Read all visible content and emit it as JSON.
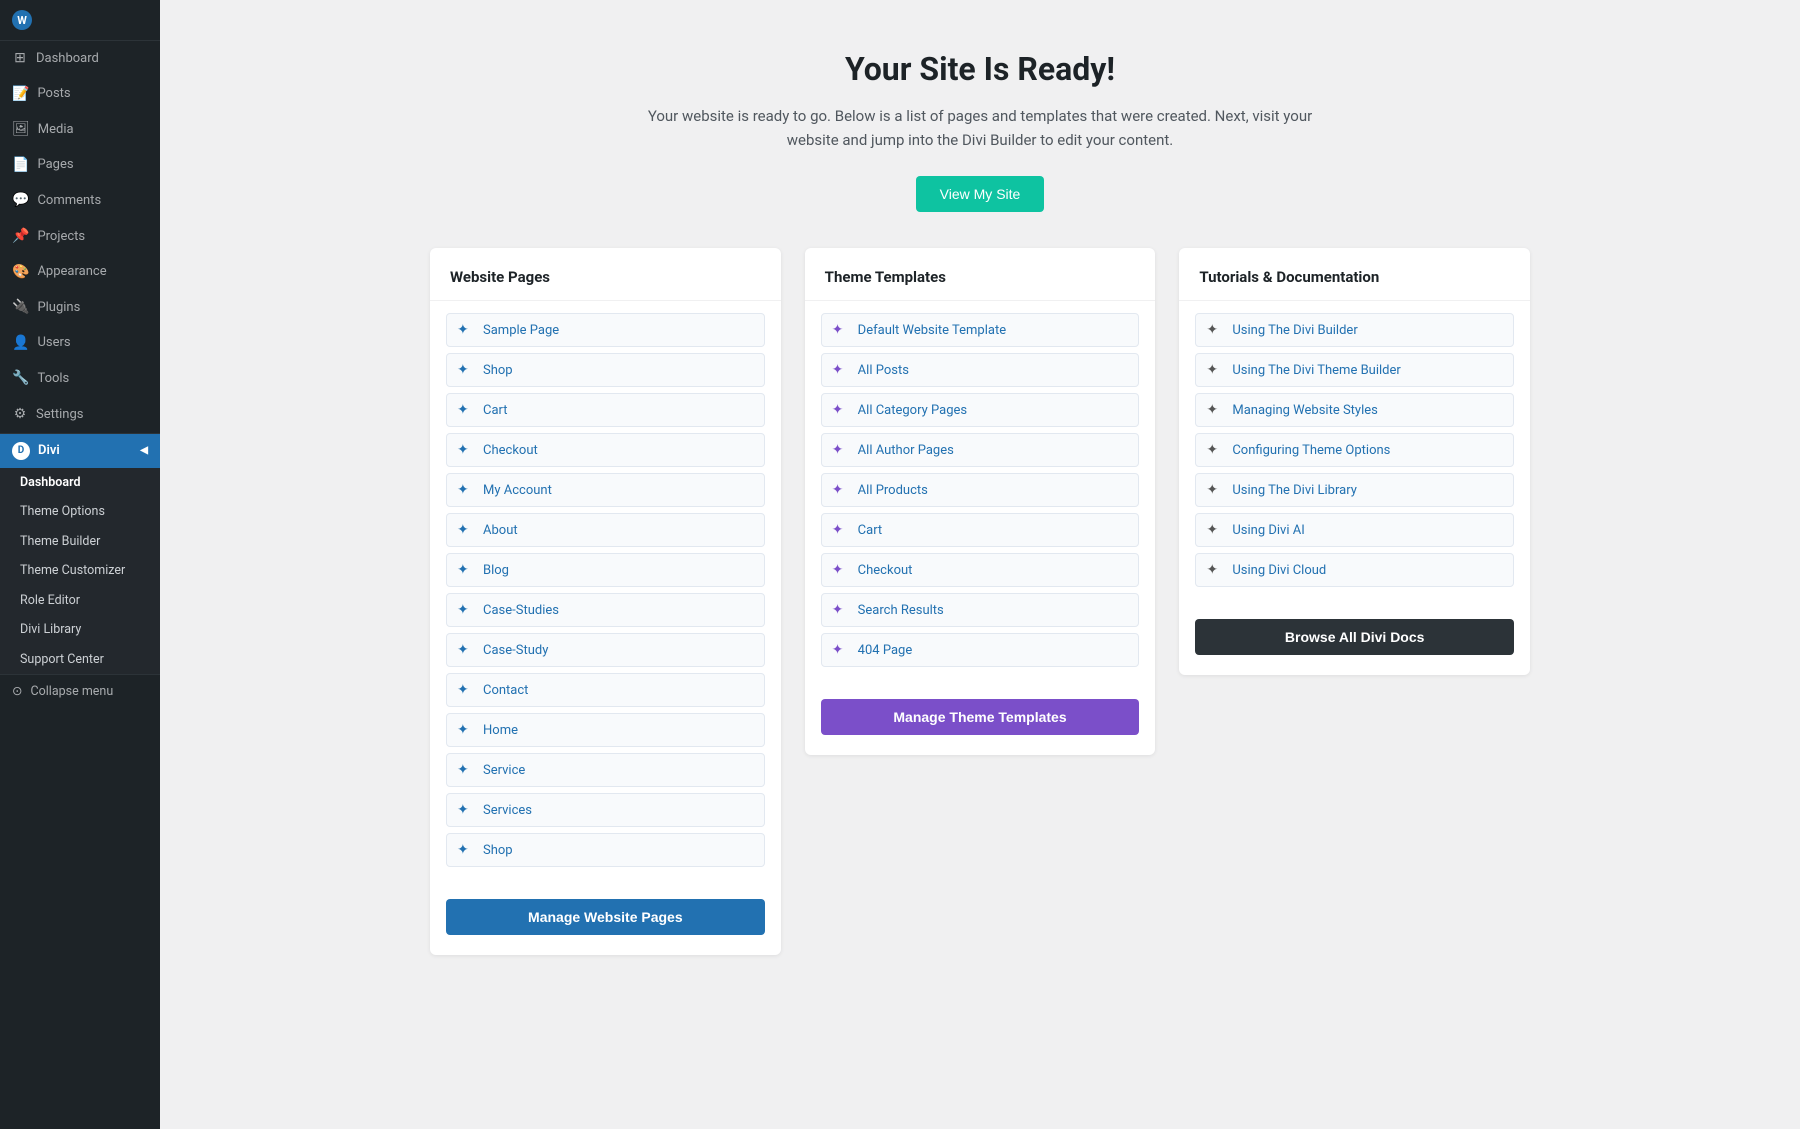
{
  "sidebar": {
    "logo": "W",
    "top_items": [
      {
        "id": "dashboard",
        "label": "Dashboard",
        "icon": "⊞"
      },
      {
        "id": "posts",
        "label": "Posts",
        "icon": "📝"
      },
      {
        "id": "media",
        "label": "Media",
        "icon": "🖼"
      },
      {
        "id": "pages",
        "label": "Pages",
        "icon": "📄"
      },
      {
        "id": "comments",
        "label": "Comments",
        "icon": "💬"
      },
      {
        "id": "projects",
        "label": "Projects",
        "icon": "📌"
      },
      {
        "id": "appearance",
        "label": "Appearance",
        "icon": "🎨"
      },
      {
        "id": "plugins",
        "label": "Plugins",
        "icon": "🔌"
      },
      {
        "id": "users",
        "label": "Users",
        "icon": "👤"
      },
      {
        "id": "tools",
        "label": "Tools",
        "icon": "🔧"
      },
      {
        "id": "settings",
        "label": "Settings",
        "icon": "⚙"
      }
    ],
    "divi_label": "Divi",
    "divi_sub_items": [
      {
        "id": "dashboard",
        "label": "Dashboard"
      },
      {
        "id": "theme-options",
        "label": "Theme Options"
      },
      {
        "id": "theme-builder",
        "label": "Theme Builder"
      },
      {
        "id": "theme-customizer",
        "label": "Theme Customizer"
      },
      {
        "id": "role-editor",
        "label": "Role Editor"
      },
      {
        "id": "divi-library",
        "label": "Divi Library"
      },
      {
        "id": "support-center",
        "label": "Support Center"
      }
    ],
    "collapse_label": "Collapse menu"
  },
  "main": {
    "title": "Your Site Is Ready!",
    "description": "Your website is ready to go. Below is a list of pages and templates that were created. Next, visit your website and jump into the Divi Builder to edit your content.",
    "view_site_btn": "View My Site",
    "columns": [
      {
        "id": "website-pages",
        "header": "Website Pages",
        "items": [
          {
            "label": "Sample Page"
          },
          {
            "label": "Shop"
          },
          {
            "label": "Cart"
          },
          {
            "label": "Checkout"
          },
          {
            "label": "My Account"
          },
          {
            "label": "About"
          },
          {
            "label": "Blog"
          },
          {
            "label": "Case-Studies"
          },
          {
            "label": "Case-Study"
          },
          {
            "label": "Contact"
          },
          {
            "label": "Home"
          },
          {
            "label": "Service"
          },
          {
            "label": "Services"
          },
          {
            "label": "Shop"
          }
        ],
        "button_label": "Manage Website Pages",
        "button_class": "blue"
      },
      {
        "id": "theme-templates",
        "header": "Theme Templates",
        "items": [
          {
            "label": "Default Website Template"
          },
          {
            "label": "All Posts"
          },
          {
            "label": "All Category Pages"
          },
          {
            "label": "All Author Pages"
          },
          {
            "label": "All Products"
          },
          {
            "label": "Cart"
          },
          {
            "label": "Checkout"
          },
          {
            "label": "Search Results"
          },
          {
            "label": "404 Page"
          }
        ],
        "button_label": "Manage Theme Templates",
        "button_class": "purple"
      },
      {
        "id": "tutorials-docs",
        "header": "Tutorials & Documentation",
        "items": [
          {
            "label": "Using The Divi Builder"
          },
          {
            "label": "Using The Divi Theme Builder"
          },
          {
            "label": "Managing Website Styles"
          },
          {
            "label": "Configuring Theme Options"
          },
          {
            "label": "Using The Divi Library"
          },
          {
            "label": "Using Divi AI"
          },
          {
            "label": "Using Divi Cloud"
          }
        ],
        "button_label": "Browse All Divi Docs",
        "button_class": "dark"
      }
    ]
  }
}
